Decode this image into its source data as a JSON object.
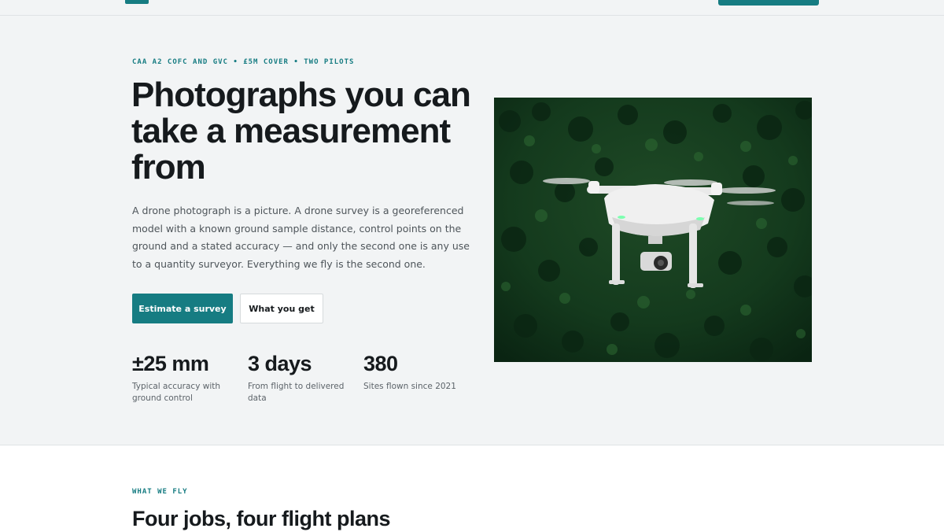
{
  "colors": {
    "accent": "#167c82",
    "hero_background": "#f2f4f5",
    "heading": "#161a1d",
    "body_text": "#4e555a"
  },
  "header": {
    "logo_icon": "logo-mark-icon"
  },
  "hero": {
    "eyebrow": "CAA A2 COFC AND GVC • £5M COVER • TWO PILOTS",
    "headline": "Photographs you can take a measurement from",
    "lede": "A drone photograph is a picture. A drone survey is a georeferenced model with a known ground sample distance, control points on the ground and a stated accuracy — and only the second one is any use to a quantity surveyor. Everything we fly is the second one.",
    "primary_button": "Estimate a survey",
    "secondary_button": "What you get",
    "stats": [
      {
        "value": "±25 mm",
        "label": "Typical accuracy with ground control"
      },
      {
        "value": "3 days",
        "label": "From flight to delivered data"
      },
      {
        "value": "380",
        "label": "Sites flown since 2021"
      }
    ],
    "image_subject": "drone-over-forest"
  },
  "services": {
    "eyebrow": "WHAT WE FLY",
    "title": "Four jobs, four flight plans"
  }
}
